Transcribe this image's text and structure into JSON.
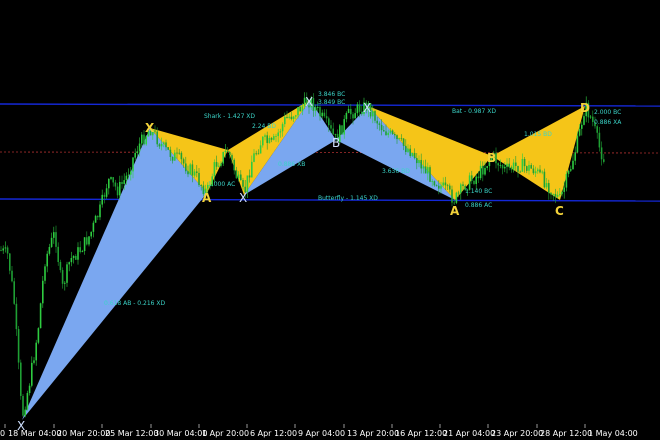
{
  "colors": {
    "background": "#000000",
    "bull_candle": "#2ecc40",
    "bear_candle": "#2ecc40",
    "pattern_blue": "#7aa7f0",
    "pattern_yellow": "#f5c518",
    "level_line": "#1428d8",
    "mid_line": "#b03030",
    "label": "#3bd4c8",
    "point_label": "#f2d23a",
    "axis_text": "#ffffff"
  },
  "x_axis": {
    "tick_labels": [
      "18 Mar 04:00",
      "20 Mar 20:00",
      "25 Mar 12:00",
      "30 Mar 04:00",
      "1 Apr 20:00",
      "6 Apr 12:00",
      "9 Apr 04:00",
      "13 Apr 20:00",
      "16 Apr 12:00",
      "21 Apr 04:00",
      "23 Apr 20:00",
      "28 Apr 12:00",
      "1 May 04:00"
    ],
    "left_edge_label": "0"
  },
  "pattern_labels": [
    {
      "text": "Shark - 1.427 XD",
      "name": "shark-label"
    },
    {
      "text": "Bat - 0.987 XD",
      "name": "bat-label"
    },
    {
      "text": "Butterfly - 1.145 XD",
      "name": "butterfly-label"
    },
    {
      "text": "0.618 AB - 0.216 XD",
      "name": "ab-xd-label"
    },
    {
      "text": "3.846 BC",
      "name": "bc-label-top1"
    },
    {
      "text": "3.849 BC",
      "name": "bc-label-top2"
    },
    {
      "text": "0.886 XA",
      "name": "xa-label"
    },
    {
      "text": "2.000 BC",
      "name": "bc-label-right"
    },
    {
      "text": "1.015 BD",
      "name": "bd-label-right"
    },
    {
      "text": "3.636 BD",
      "name": "bd-label-mid"
    },
    {
      "text": "1.000 AC",
      "name": "ac-label-left"
    },
    {
      "text": "1.140 BC",
      "name": "bc-label-low"
    },
    {
      "text": "0.886 AC",
      "name": "ac-label-low"
    },
    {
      "text": "2.24 BD",
      "name": "bd-label-left"
    },
    {
      "text": "0.886 XB",
      "name": "xb-label"
    }
  ],
  "point_labels": [
    {
      "text": "X",
      "name": "point-x-1"
    },
    {
      "text": "A",
      "name": "point-a-1"
    },
    {
      "text": "X",
      "name": "point-x-2"
    },
    {
      "text": "B",
      "name": "point-b-1"
    },
    {
      "text": "X",
      "name": "point-x-3"
    },
    {
      "text": "X",
      "name": "point-x-4"
    },
    {
      "text": "A",
      "name": "point-a-2"
    },
    {
      "text": "B",
      "name": "point-b-2"
    },
    {
      "text": "C",
      "name": "point-c-1"
    },
    {
      "text": "D",
      "name": "point-d-1"
    },
    {
      "text": "X",
      "name": "point-x-0"
    }
  ]
}
